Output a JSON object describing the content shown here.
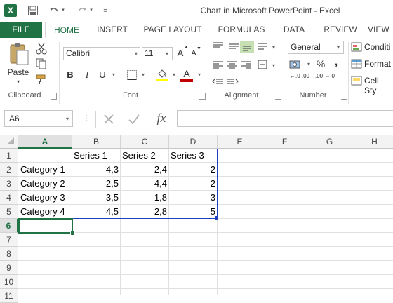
{
  "app": {
    "icon_letter": "X",
    "window_title": "Chart in Microsoft PowerPoint - Excel"
  },
  "qat": {
    "save_icon": "save-icon",
    "undo_icon": "undo-icon",
    "redo_icon": "redo-icon"
  },
  "tabs": [
    "FILE",
    "HOME",
    "INSERT",
    "PAGE LAYOUT",
    "FORMULAS",
    "DATA",
    "REVIEW",
    "VIEW"
  ],
  "ribbon": {
    "clipboard": {
      "label": "Clipboard",
      "paste": "Paste"
    },
    "font": {
      "label": "Font",
      "name": "Calibri",
      "size": "11",
      "grow": "A",
      "shrink": "A",
      "bold": "B",
      "italic": "I",
      "underline": "U",
      "fill_color": "#ffff00",
      "font_color_letter": "A",
      "font_color": "#c00000"
    },
    "alignment": {
      "label": "Alignment"
    },
    "number": {
      "label": "Number",
      "format": "General",
      "percent": "%",
      "comma": ",",
      "inc_decimal": "←.0 .00",
      "dec_decimal": ".00 →.0"
    },
    "styles": {
      "conditional": "Conditi",
      "format_as": "Format",
      "cell_styles": "Cell Sty"
    }
  },
  "formula_bar": {
    "name_box": "A6",
    "fx": "fx",
    "value": ""
  },
  "sheet": {
    "columns": [
      "A",
      "B",
      "C",
      "D",
      "E",
      "F",
      "G",
      "H"
    ],
    "rows": [
      "1",
      "2",
      "3",
      "4",
      "5",
      "6",
      "7",
      "8",
      "9",
      "10",
      "11"
    ],
    "selected_cell": "A6",
    "cells": {
      "B1": "Series 1",
      "C1": "Series 2",
      "D1": "Series 3",
      "A2": "Category 1",
      "B2": "4,3",
      "C2": "2,4",
      "D2": "2",
      "A3": "Category 2",
      "B3": "2,5",
      "C3": "4,4",
      "D3": "2",
      "A4": "Category 3",
      "B4": "3,5",
      "C4": "1,8",
      "D4": "3",
      "A5": "Category 4",
      "B5": "4,5",
      "C5": "2,8",
      "D5": "5"
    }
  }
}
